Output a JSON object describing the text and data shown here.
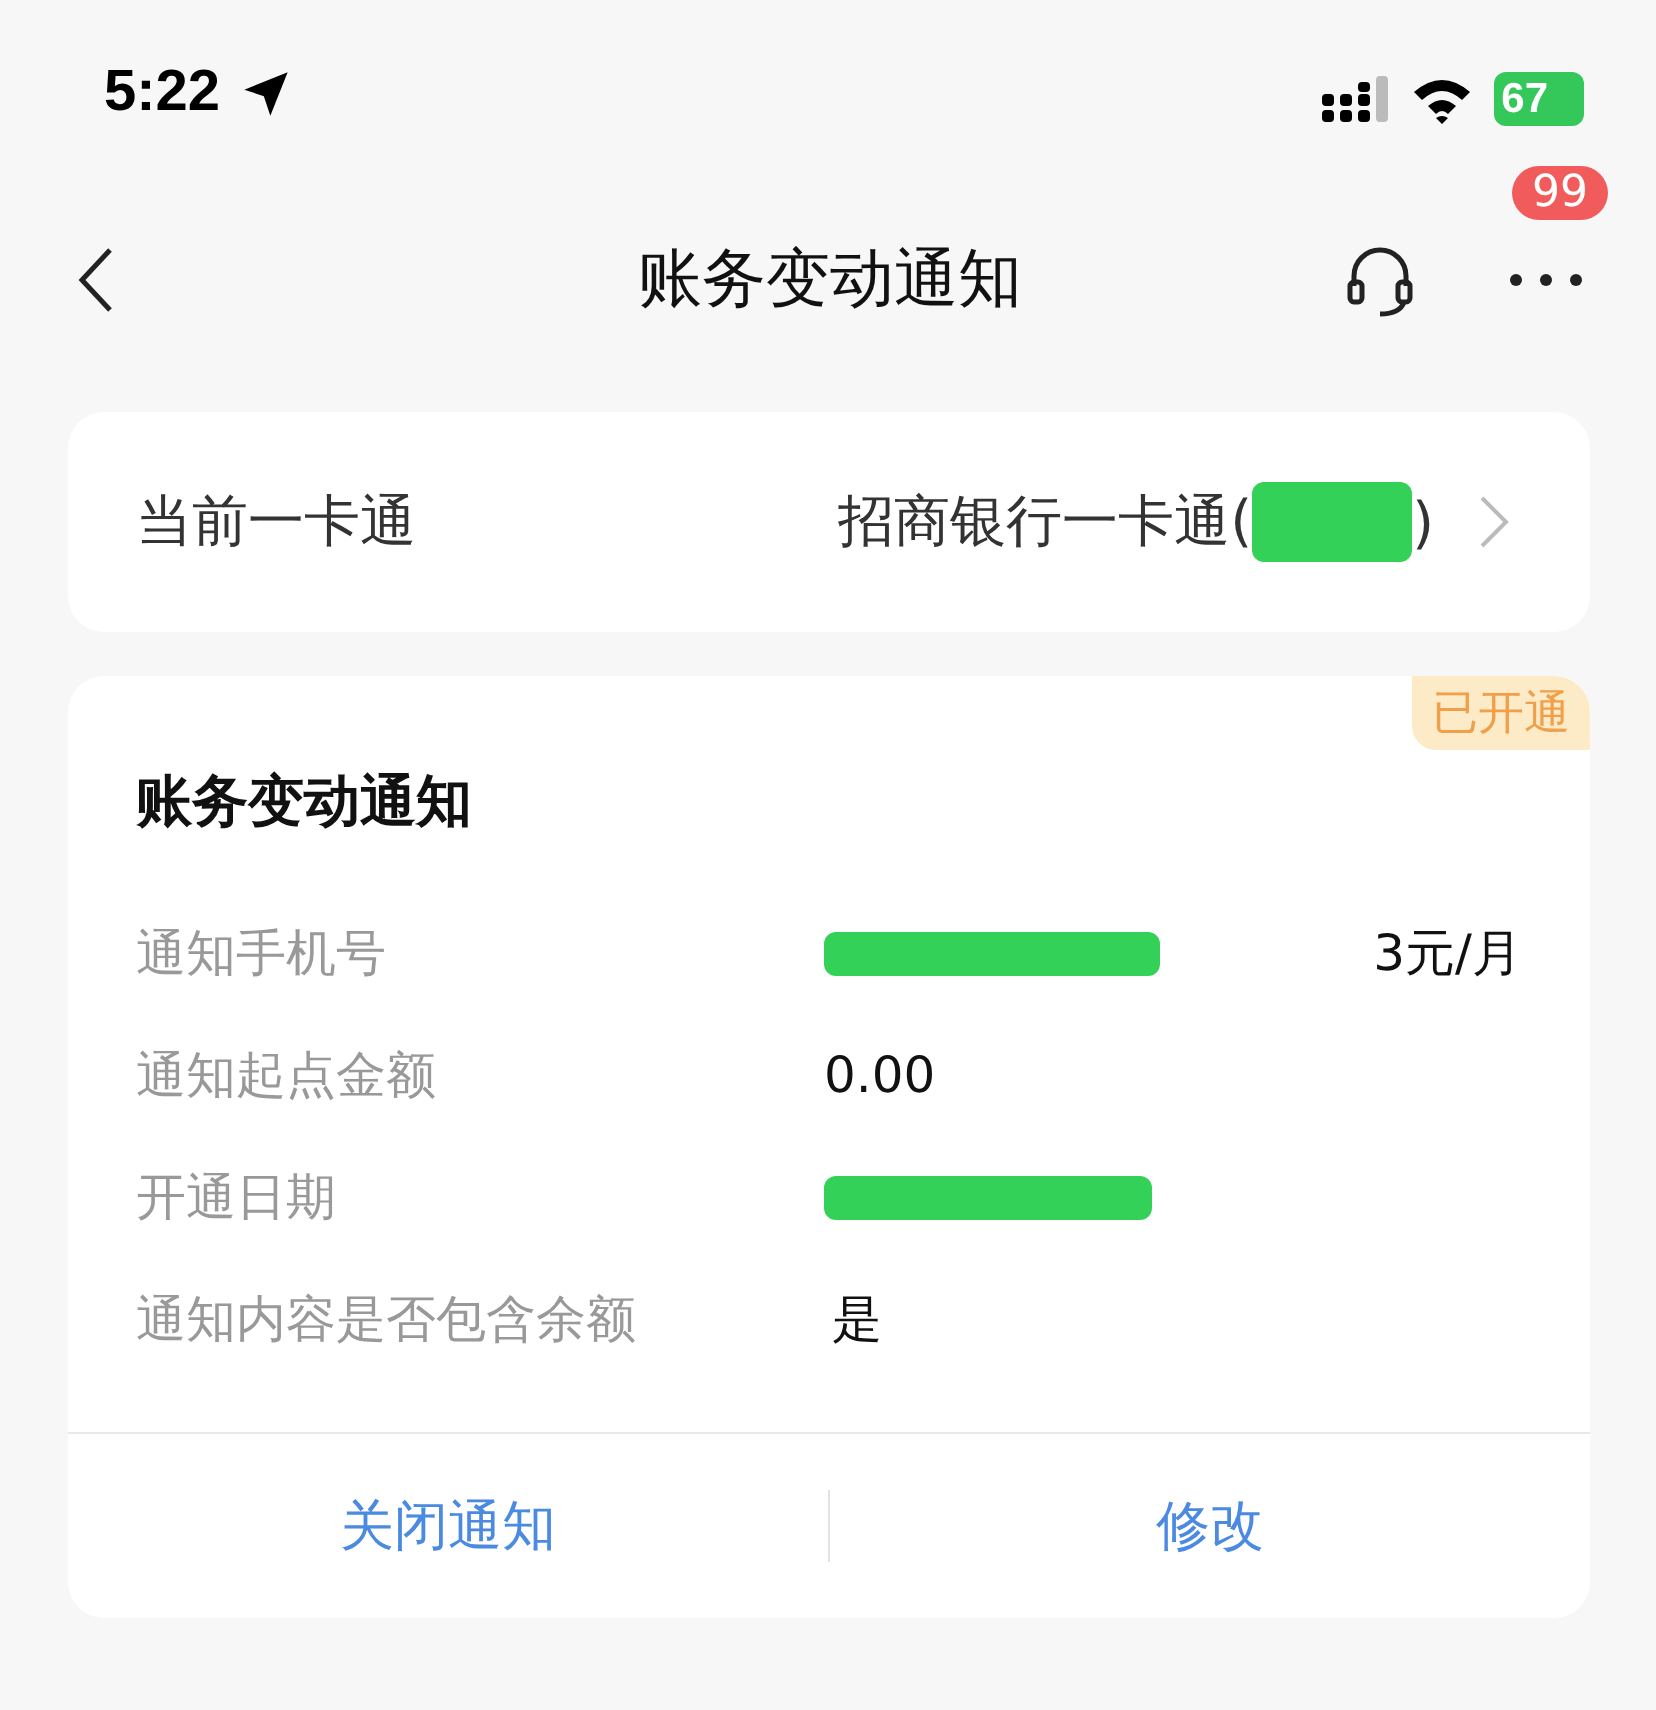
{
  "status_bar": {
    "time": "5:22",
    "battery": "67"
  },
  "nav_bar": {
    "title": "账务变动通知",
    "badge": "99"
  },
  "card_selector": {
    "label": "当前一卡通",
    "value_prefix": "招商银行一卡通(",
    "value_suffix": ")"
  },
  "notice_card": {
    "title": "账务变动通知",
    "status": "已开通",
    "rows": [
      {
        "label": "通知手机号",
        "kind": "redacted",
        "extra": "3元/月"
      },
      {
        "label": "通知起点金额",
        "kind": "text",
        "value": "0.00"
      },
      {
        "label": "开通日期",
        "kind": "redacted"
      },
      {
        "label": "通知内容是否包含余额",
        "kind": "text",
        "value": "是"
      }
    ],
    "actions": [
      "关闭通知",
      "修改"
    ]
  }
}
